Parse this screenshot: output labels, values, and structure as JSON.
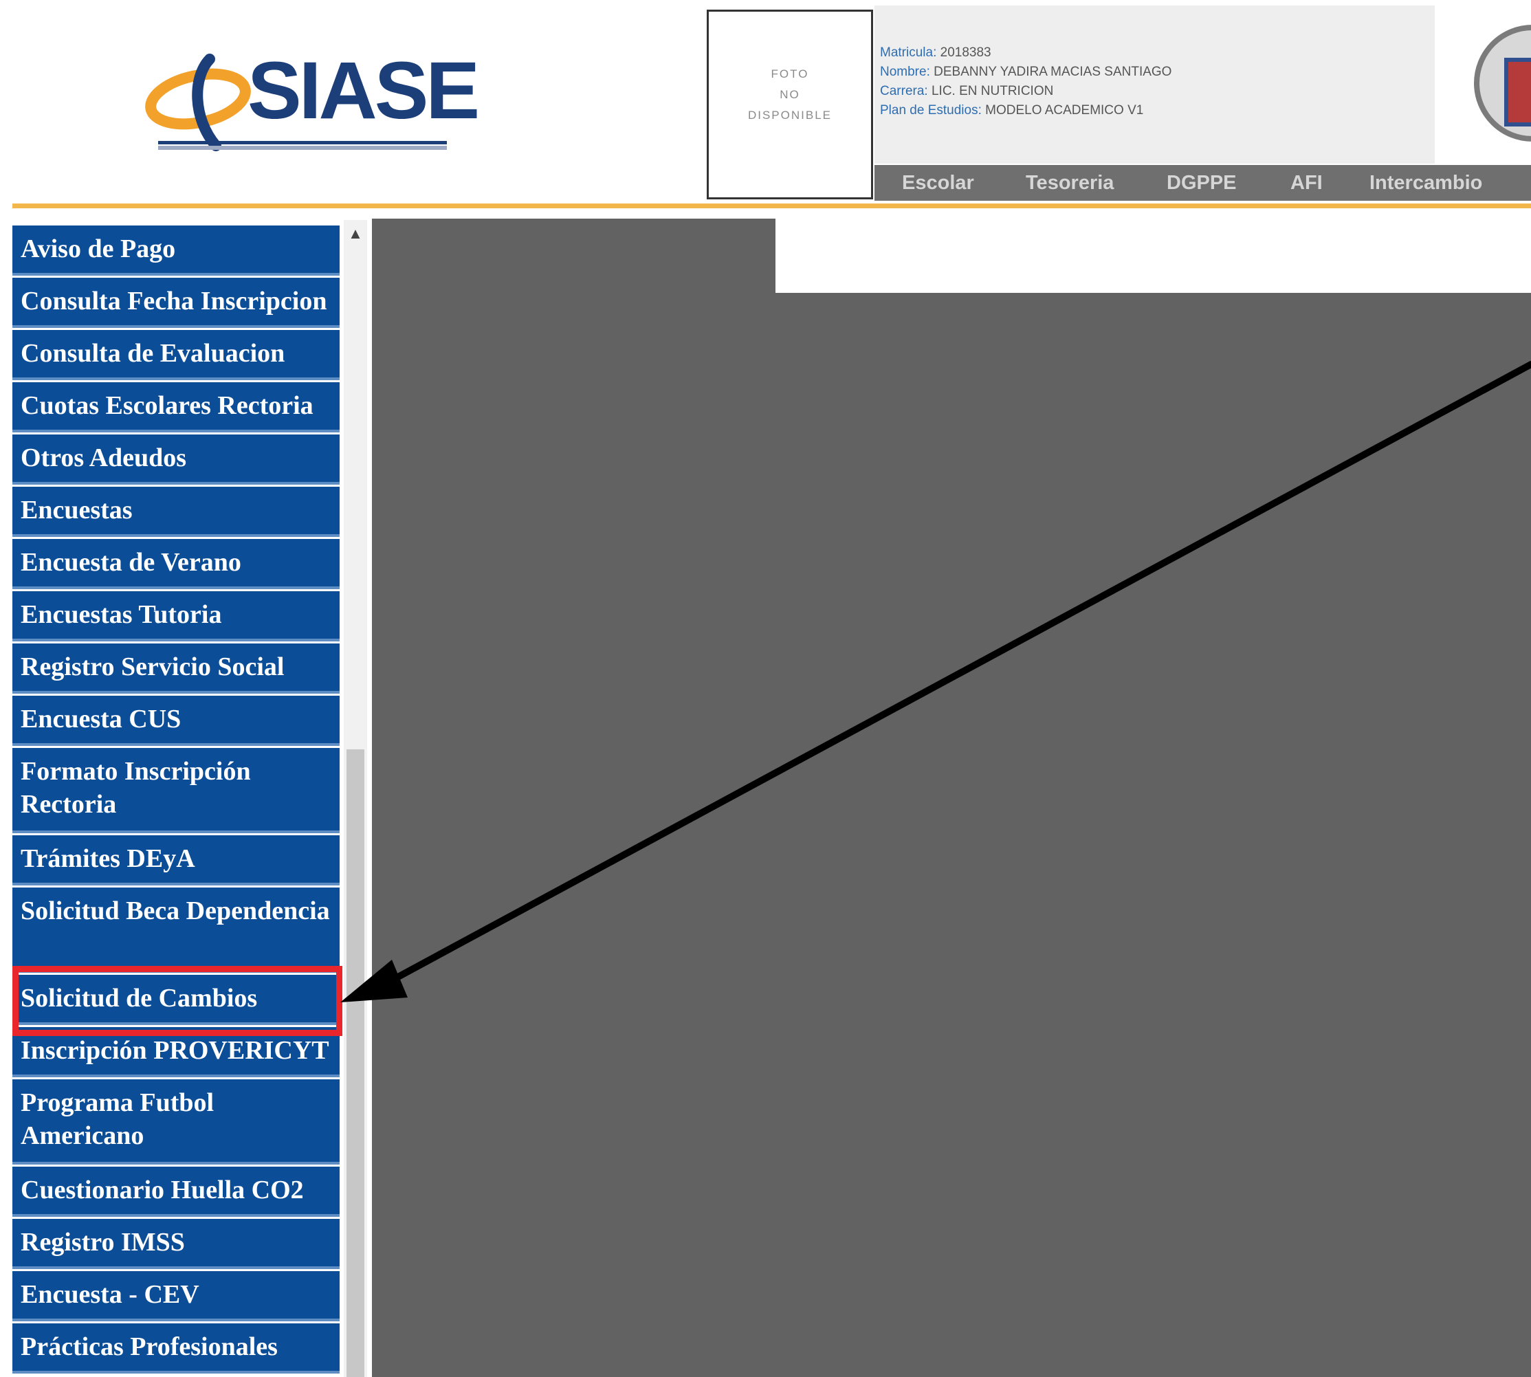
{
  "header": {
    "logo_text": "SIASE",
    "photo_placeholder": [
      "FOTO",
      "NO",
      "DISPONIBLE"
    ],
    "student": [
      {
        "label": "Matricula:",
        "value": "2018383"
      },
      {
        "label": "Nombre:",
        "value": "DEBANNY YADIRA MACIAS SANTIAGO"
      },
      {
        "label": "Carrera:",
        "value": "LIC. EN NUTRICION"
      },
      {
        "label": "Plan de Estudios:",
        "value": "MODELO ACADEMICO V1"
      }
    ],
    "menu": [
      "Escolar",
      "Tesoreria",
      "DGPPE",
      "AFI",
      "Intercambio"
    ]
  },
  "sidebar": {
    "items": [
      {
        "label": "Aviso de Pago"
      },
      {
        "label": "Consulta Fecha Inscripcion"
      },
      {
        "label": "Consulta de Evaluacion"
      },
      {
        "label": "Cuotas Escolares Rectoria"
      },
      {
        "label": "Otros Adeudos"
      },
      {
        "label": "Encuestas"
      },
      {
        "label": "Encuesta de Verano"
      },
      {
        "label": "Encuestas Tutoria"
      },
      {
        "label": "Registro Servicio Social"
      },
      {
        "label": "Encuesta CUS"
      },
      {
        "label": "Formato Inscripción Rectoria"
      },
      {
        "label": "Trámites DEyA"
      },
      {
        "label": "Solicitud Beca Dependencia"
      },
      {
        "label": "Solicitud de Cambios"
      },
      {
        "label": "Inscripción PROVERICYT"
      },
      {
        "label": "Programa Futbol Americano"
      },
      {
        "label": "Cuestionario Huella CO2"
      },
      {
        "label": "Registro IMSS"
      },
      {
        "label": "Encuesta - CEV"
      },
      {
        "label": "Prácticas Profesionales"
      }
    ],
    "highlighted_item": "Solicitud de Cambios"
  },
  "colors": {
    "nav_blue": "#0c4d97",
    "accent_gold": "#f2b64a",
    "highlight_red": "#e8262c",
    "content_gray": "#626262"
  },
  "icons": [
    "logo-icon",
    "crest-icon",
    "scroll-up-icon",
    "annotation-arrow"
  ]
}
